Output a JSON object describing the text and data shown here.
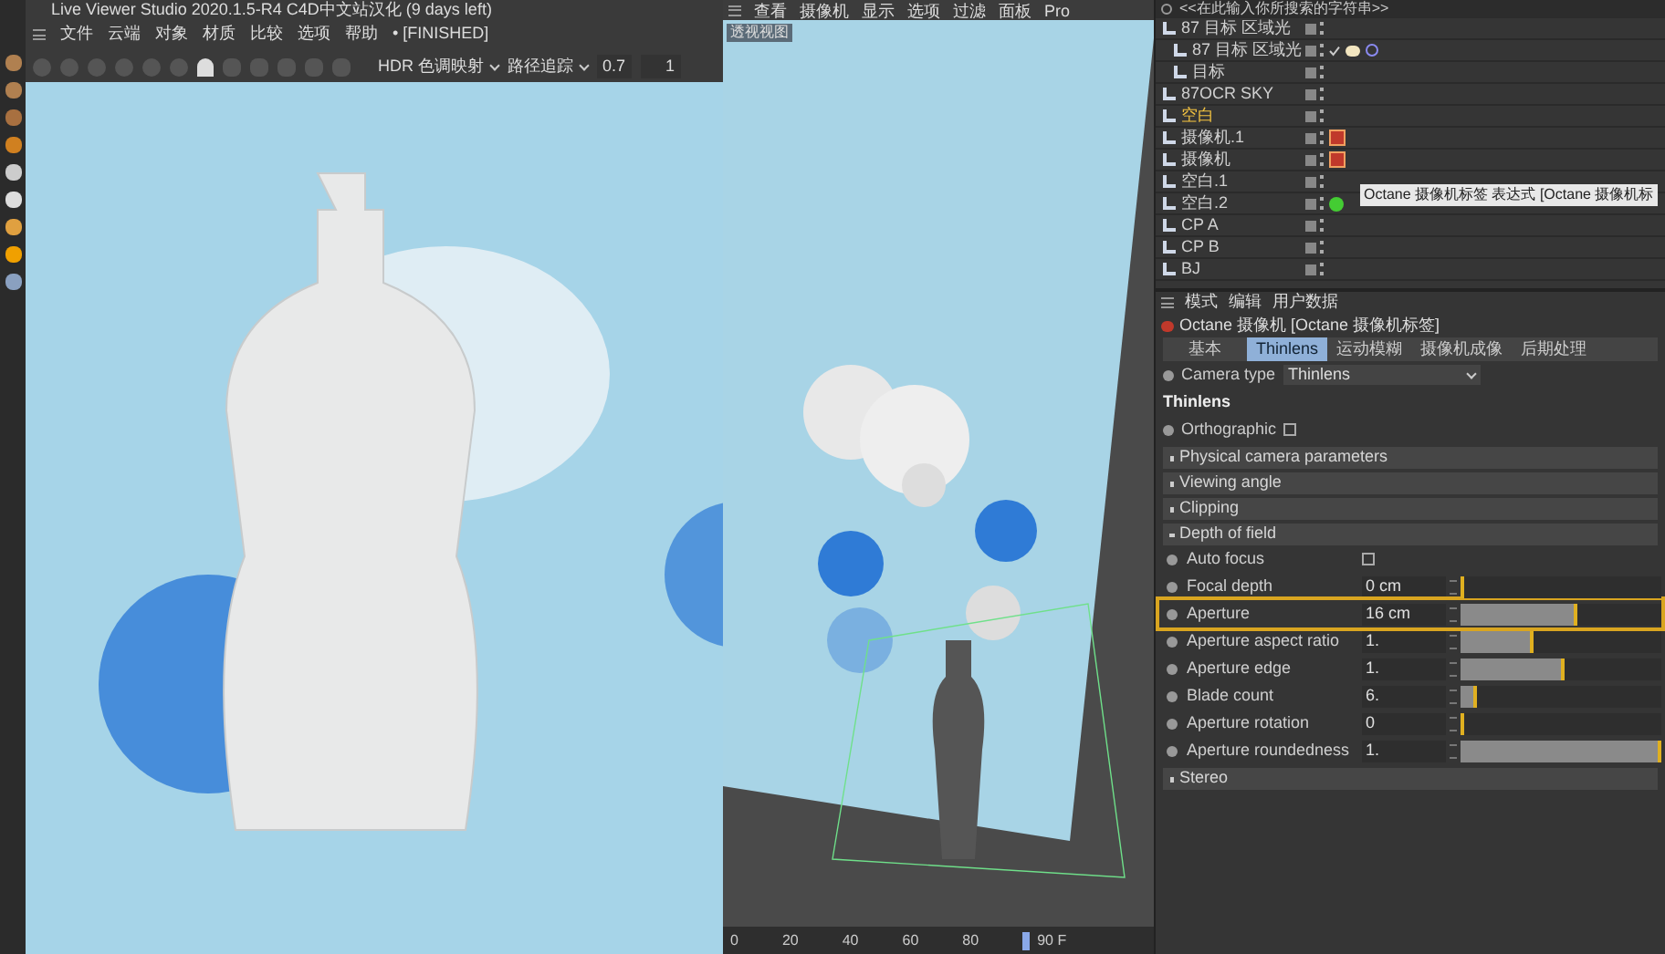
{
  "viewer": {
    "title": "Live Viewer Studio 2020.1.5-R4 C4D中文站汉化 (9 days left)",
    "menu": [
      "文件",
      "云端",
      "对象",
      "材质",
      "比较",
      "选项",
      "帮助"
    ],
    "status": "• [FINISHED]",
    "toolbar": {
      "tonemap": "HDR 色调映射",
      "kernel": "路径追踪",
      "value_1": "0.7",
      "value_2": "1"
    }
  },
  "viewport": {
    "menu": [
      "查看",
      "摄像机",
      "显示",
      "选项",
      "过滤",
      "面板",
      "Pro"
    ],
    "label": "透视视图",
    "timeline": {
      "ticks": [
        "0",
        "20",
        "40",
        "60",
        "80"
      ],
      "frame": "90 F"
    }
  },
  "objects": {
    "search": "<<在此输入你所搜索的字符串>>",
    "items": [
      {
        "name": "87 目标 区域光",
        "kind": "null",
        "selected": false,
        "children": [
          {
            "name": "87 目标 区域光",
            "kind": "light",
            "selected": false
          },
          {
            "name": "目标",
            "kind": "null",
            "selected": false
          }
        ]
      },
      {
        "name": "87OCR SKY",
        "kind": "null",
        "selected": false
      },
      {
        "name": "空白",
        "kind": "null",
        "selected": true
      },
      {
        "name": "摄像机.1",
        "kind": "camera",
        "selected": false
      },
      {
        "name": "摄像机",
        "kind": "camera",
        "selected": false
      },
      {
        "name": "空白.1",
        "kind": "null",
        "selected": false
      },
      {
        "name": "空白.2",
        "kind": "tagged",
        "selected": false
      },
      {
        "name": "CP A",
        "kind": "null",
        "selected": false
      },
      {
        "name": "CP B",
        "kind": "null",
        "selected": false
      },
      {
        "name": "BJ",
        "kind": "null",
        "selected": false
      }
    ],
    "tooltip": "Octane 摄像机标签 表达式 [Octane 摄像机标"
  },
  "attributes": {
    "menu": [
      "模式",
      "编辑",
      "用户数据"
    ],
    "title": "Octane 摄像机 [Octane 摄像机标签]",
    "tabs": [
      {
        "label": "基本",
        "selected": false
      },
      {
        "label": "Thinlens",
        "selected": true
      },
      {
        "label": "运动模糊",
        "selected": false
      },
      {
        "label": "摄像机成像",
        "selected": false
      },
      {
        "label": "后期处理",
        "selected": false
      }
    ],
    "camera_type": {
      "label": "Camera type",
      "value": "Thinlens"
    },
    "heading": "Thinlens",
    "orthographic": {
      "label": "Orthographic",
      "checked": false
    },
    "sections_before": [
      {
        "label": "Physical camera parameters"
      },
      {
        "label": "Viewing angle"
      },
      {
        "label": "Clipping"
      }
    ],
    "depth_of_field": {
      "label": "Depth of field",
      "expanded": true,
      "params": [
        {
          "kind": "checkbox",
          "label": "Auto focus",
          "checked": false
        },
        {
          "kind": "slider",
          "label": "Focal depth",
          "value": "0 cm",
          "level": 0,
          "highlighted": false
        },
        {
          "kind": "slider",
          "label": "Aperture",
          "value": "16 cm",
          "level": 0.58,
          "highlighted": true
        },
        {
          "kind": "slider",
          "label": "Aperture aspect ratio",
          "value": "1.",
          "level": 0.36,
          "highlighted": false
        },
        {
          "kind": "slider",
          "label": "Aperture edge",
          "value": "1.",
          "level": 0.52,
          "highlighted": false
        },
        {
          "kind": "slider",
          "label": "Blade count",
          "value": "6.",
          "level": 0.08,
          "highlighted": false
        },
        {
          "kind": "slider",
          "label": "Aperture rotation",
          "value": "0",
          "level": 0,
          "highlighted": false
        },
        {
          "kind": "slider",
          "label": "Aperture roundedness",
          "value": "1.",
          "level": 1,
          "highlighted": false
        }
      ]
    },
    "sections_after": [
      {
        "label": "Stereo"
      }
    ]
  }
}
